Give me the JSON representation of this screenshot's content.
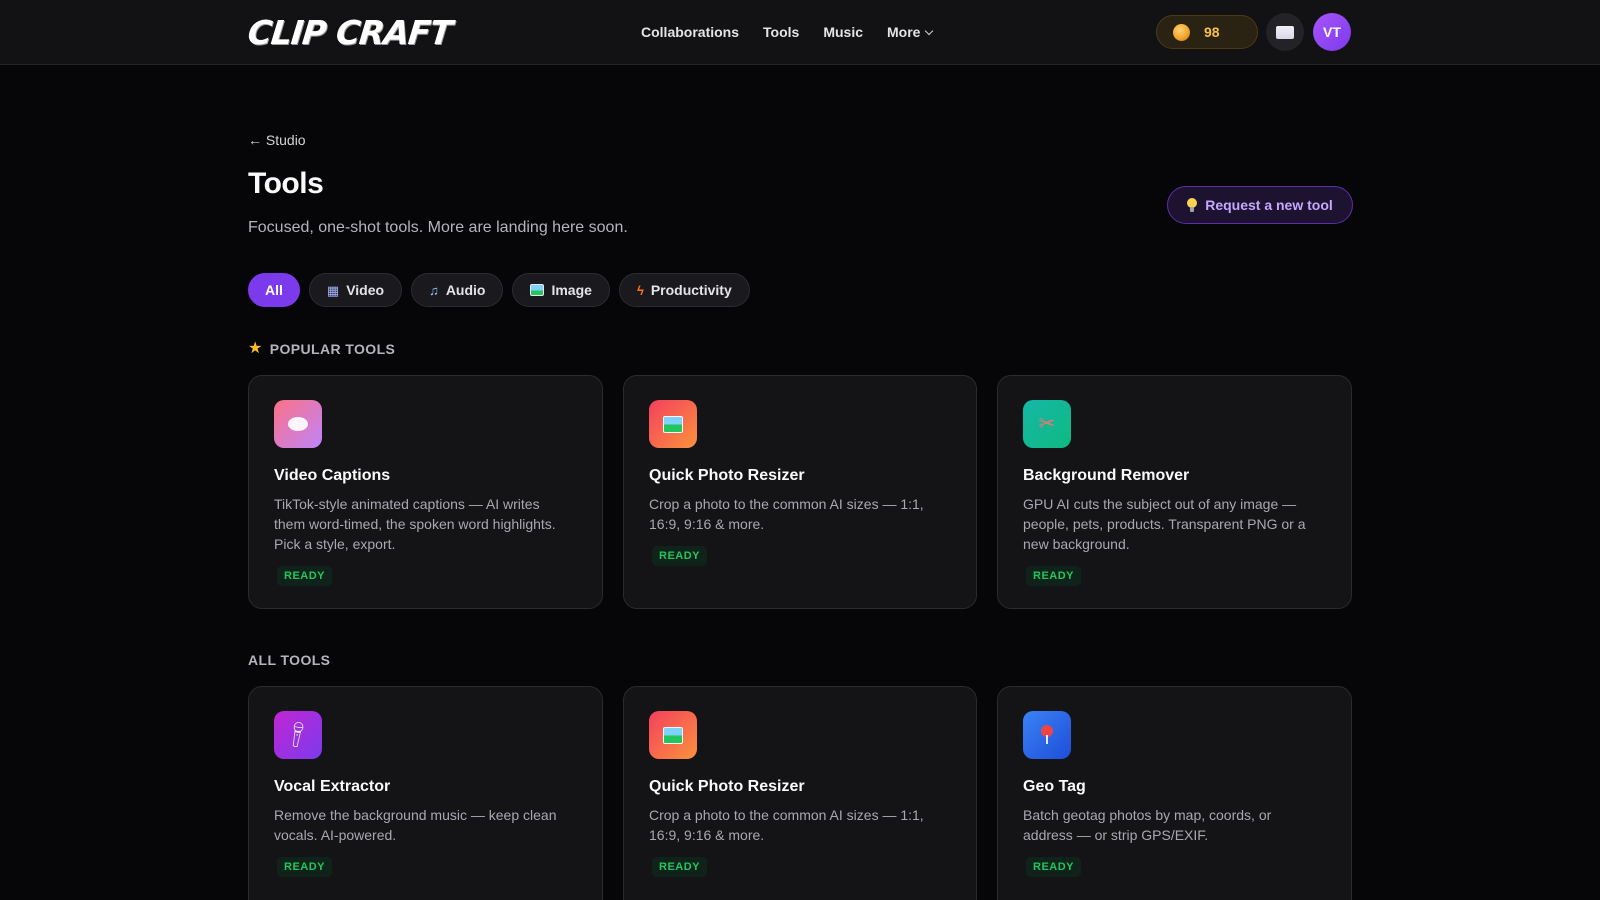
{
  "app": {
    "logo_text": "CLIP CRAFT"
  },
  "nav": {
    "items": [
      "Collaborations",
      "Tools",
      "Music",
      "More"
    ]
  },
  "user": {
    "coins": "98",
    "avatar_initials": "VT"
  },
  "header": {
    "back_label": "← Studio",
    "title": "Tools",
    "subtitle": "Focused, one-shot tools. More are landing here soon.",
    "request_button": "Request a new tool"
  },
  "filters": [
    {
      "label": "All",
      "icon": "",
      "active": true
    },
    {
      "label": "Video",
      "icon": "clapper-icon"
    },
    {
      "label": "Audio",
      "icon": "music-note-icon"
    },
    {
      "label": "Image",
      "icon": "picture-icon"
    },
    {
      "label": "Productivity",
      "icon": "lightning-icon"
    }
  ],
  "sections": {
    "popular_title": "POPULAR TOOLS",
    "all_title": "ALL TOOLS"
  },
  "popular_tools": [
    {
      "title": "Video Captions",
      "description": "TikTok-style animated captions — AI writes them word-timed, the spoken word highlights. Pick a style, export.",
      "status": "READY",
      "icon": "speech-bubble-icon"
    },
    {
      "title": "Quick Photo Resizer",
      "description": "Crop a photo to the common AI sizes — 1:1, 16:9, 9:16 & more.",
      "status": "READY",
      "icon": "photo-icon"
    },
    {
      "title": "Background Remover",
      "description": "GPU AI cuts the subject out of any image — people, pets, products. Transparent PNG or a new background.",
      "status": "READY",
      "icon": "scissors-icon"
    }
  ],
  "all_tools": [
    {
      "title": "Vocal Extractor",
      "description": "Remove the background music — keep clean vocals. AI-powered.",
      "status": "READY",
      "icon": "microphone-icon"
    },
    {
      "title": "Quick Photo Resizer",
      "description": "Crop a photo to the common AI sizes — 1:1, 16:9, 9:16 & more.",
      "status": "READY",
      "icon": "photo-icon"
    },
    {
      "title": "Geo Tag",
      "description": "Batch geotag photos by map, coords, or address — or strip GPS/EXIF.",
      "status": "READY",
      "icon": "map-pin-icon"
    }
  ],
  "colors": {
    "accent": "#7c3aed",
    "ready": "#22c55e",
    "coin": "#f7c04a",
    "background": "#060608"
  }
}
